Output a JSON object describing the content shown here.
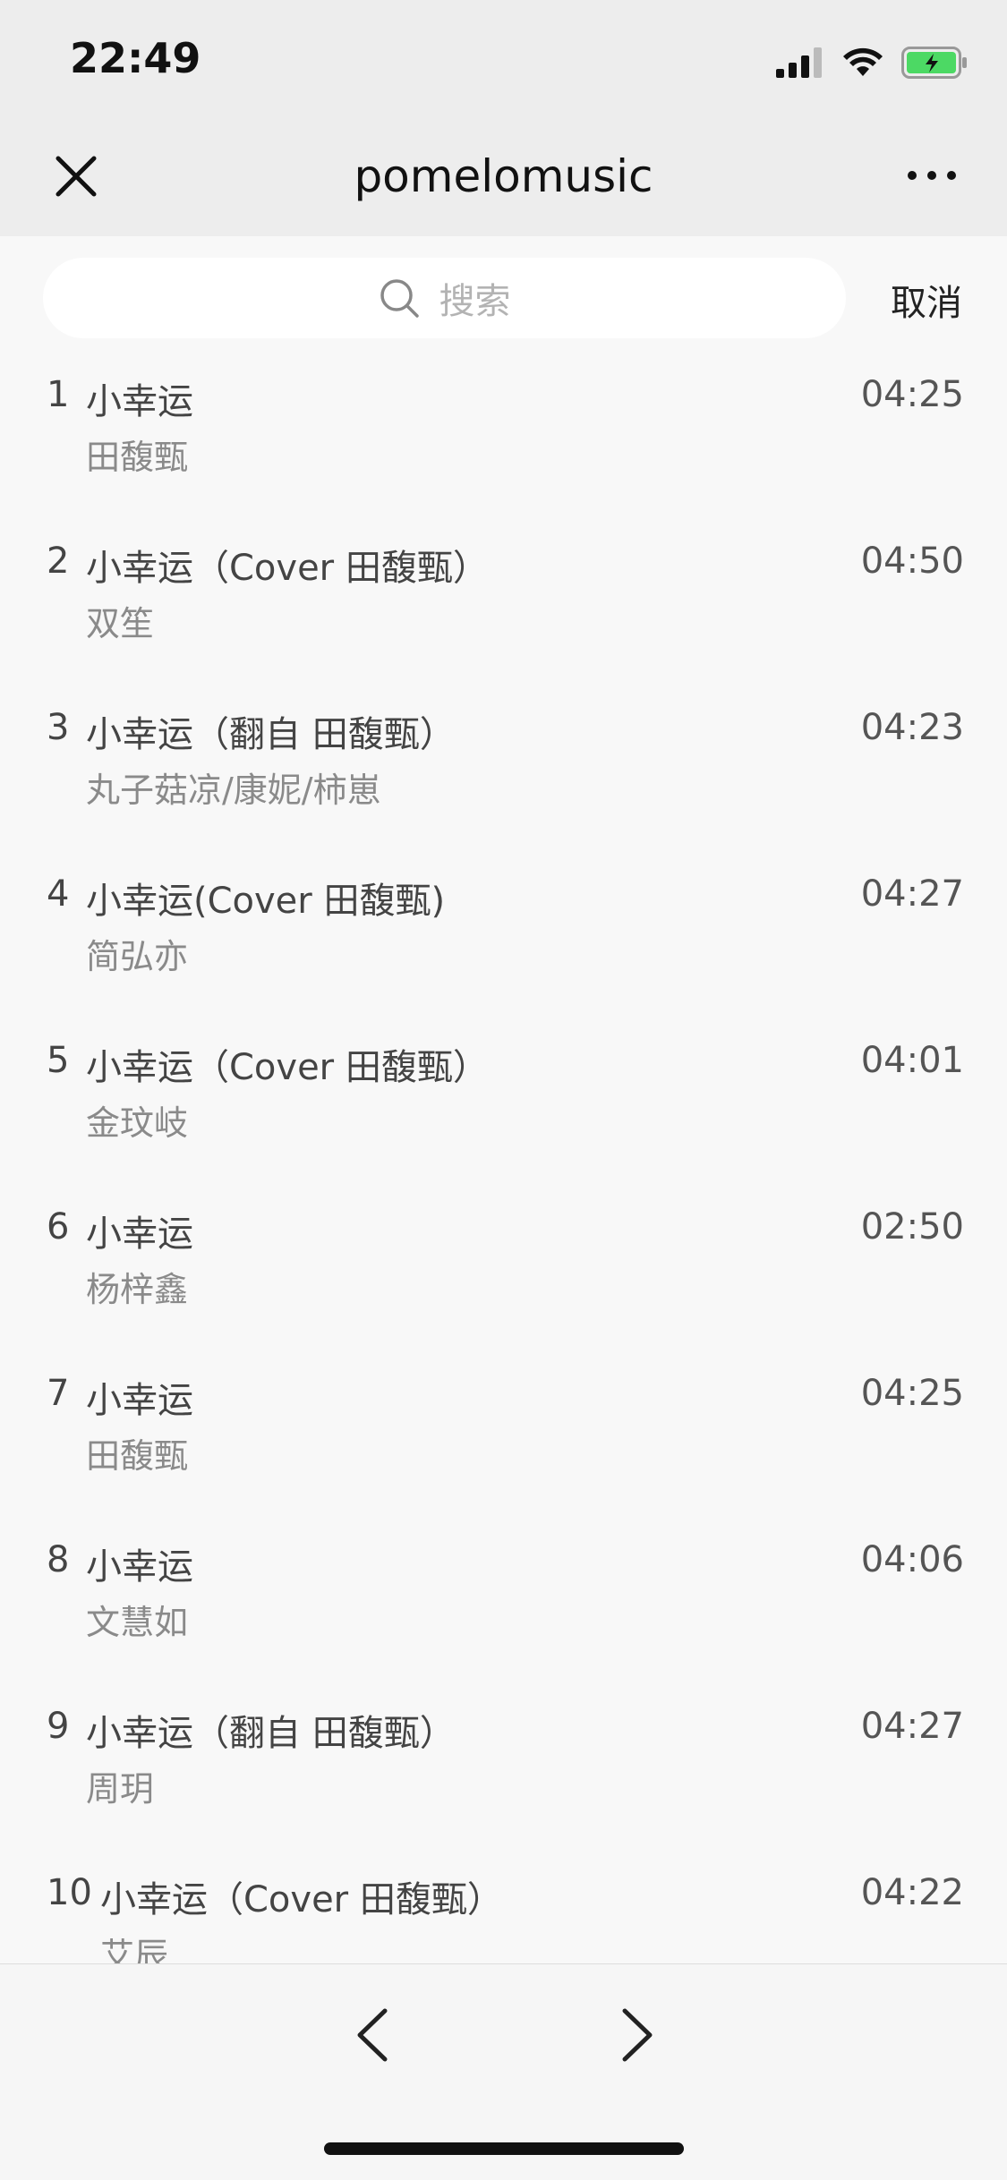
{
  "status_bar": {
    "time": "22:49"
  },
  "nav": {
    "title": "pomelomusic"
  },
  "search": {
    "placeholder": "搜索",
    "cancel_label": "取消"
  },
  "songs": [
    {
      "index": "1",
      "title": "小幸运",
      "artist": "田馥甄",
      "duration": "04:25"
    },
    {
      "index": "2",
      "title": "小幸运（Cover 田馥甄）",
      "artist": "双笙",
      "duration": "04:50"
    },
    {
      "index": "3",
      "title": "小幸运（翻自 田馥甄）",
      "artist": "丸子菇凉/康妮/柿崽",
      "duration": "04:23"
    },
    {
      "index": "4",
      "title": "小幸运(Cover 田馥甄)",
      "artist": "简弘亦",
      "duration": "04:27"
    },
    {
      "index": "5",
      "title": "小幸运（Cover 田馥甄）",
      "artist": "金玟岐",
      "duration": "04:01"
    },
    {
      "index": "6",
      "title": "小幸运",
      "artist": "杨梓鑫",
      "duration": "02:50"
    },
    {
      "index": "7",
      "title": "小幸运",
      "artist": "田馥甄",
      "duration": "04:25"
    },
    {
      "index": "8",
      "title": "小幸运",
      "artist": "文慧如",
      "duration": "04:06"
    },
    {
      "index": "9",
      "title": "小幸运（翻自 田馥甄）",
      "artist": "周玥",
      "duration": "04:27"
    },
    {
      "index": "10",
      "title": "小幸运（Cover 田馥甄）",
      "artist": "艾辰",
      "duration": "04:22"
    }
  ],
  "colors": {
    "battery_fill": "#4cd964",
    "bar_bg": "#ededed",
    "page_bg": "#f8f8f8"
  }
}
